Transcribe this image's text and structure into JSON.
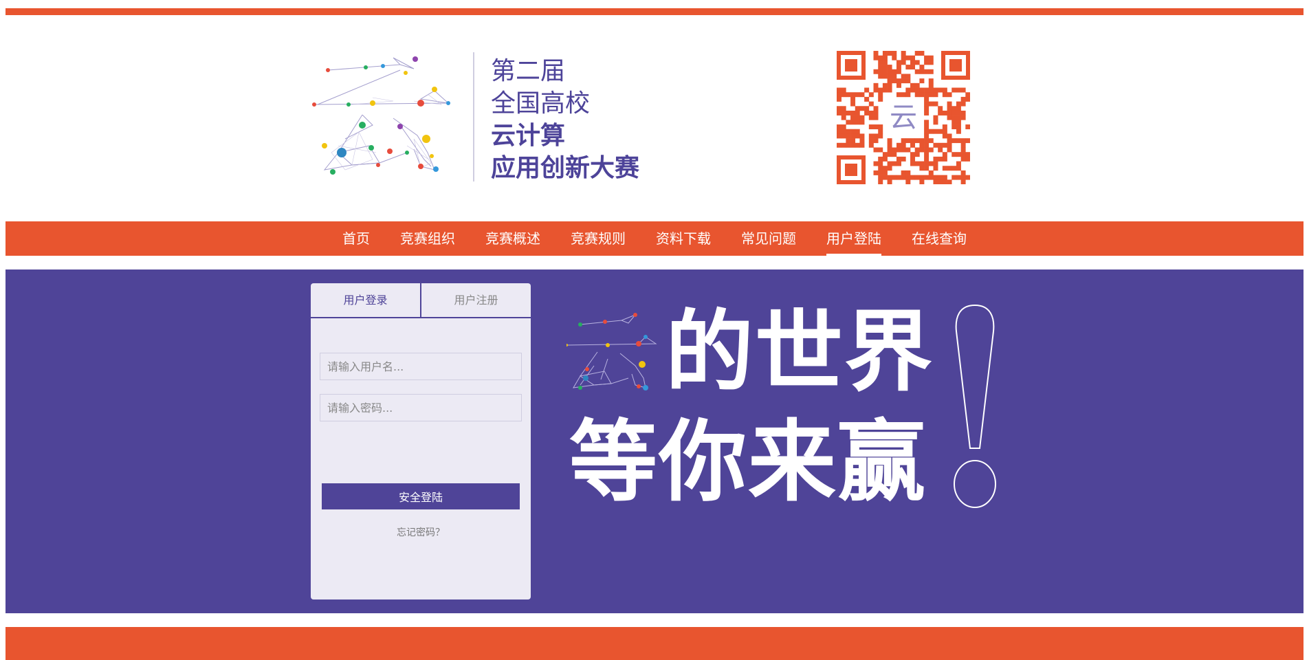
{
  "header": {
    "logo": {
      "line1": "第二届",
      "line2": "全国高校",
      "line3": "云计算",
      "line4": "应用创新大赛",
      "icon": "yun-network-logo"
    },
    "qr_code": {
      "icon": "qr-code-icon",
      "center_char": "云"
    }
  },
  "nav": {
    "items": [
      {
        "label": "首页"
      },
      {
        "label": "竞赛组织"
      },
      {
        "label": "竞赛概述"
      },
      {
        "label": "竞赛规则"
      },
      {
        "label": "资料下载"
      },
      {
        "label": "常见问题"
      },
      {
        "label": "用户登陆",
        "active": true
      },
      {
        "label": "在线查询"
      }
    ]
  },
  "login": {
    "tab_login": "用户登录",
    "tab_register": "用户注册",
    "username_placeholder": "请输入用户名...",
    "password_placeholder": "请输入密码...",
    "submit_label": "安全登陆",
    "forgot_label": "忘记密码？"
  },
  "hero": {
    "line1": "的世界",
    "line2": "等你来赢",
    "bang": "!"
  },
  "colors": {
    "orange": "#e8552f",
    "purple": "#4f4498",
    "card_bg": "#eceaf4"
  }
}
